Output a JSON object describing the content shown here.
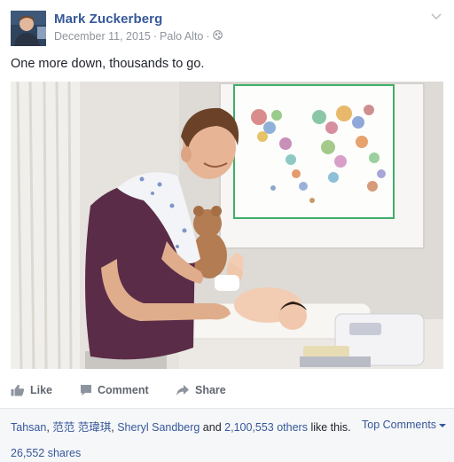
{
  "post": {
    "author": "Mark Zuckerberg",
    "date": "December 11, 2015",
    "location": "Palo Alto",
    "dot": "·",
    "text": "One more down, thousands to go."
  },
  "actions": {
    "like": "Like",
    "comment": "Comment",
    "share": "Share"
  },
  "reactions": {
    "names": [
      "Tahsan",
      "范范 范瑋琪",
      "Sheryl Sandberg"
    ],
    "sep1": ", ",
    "sep2": ", ",
    "and_text": " and ",
    "others": "2,100,553 others",
    "like_suffix": " like this.",
    "top_comments": "Top Comments",
    "shares": "26,552 shares"
  },
  "icons": [
    "globe-icon",
    "chevron-down-icon",
    "like-icon",
    "comment-icon",
    "share-icon",
    "caret-down-icon"
  ],
  "colors": {
    "link": "#365899",
    "muted": "#90949c",
    "action": "#616770",
    "footer_bg": "#f6f7f9"
  }
}
